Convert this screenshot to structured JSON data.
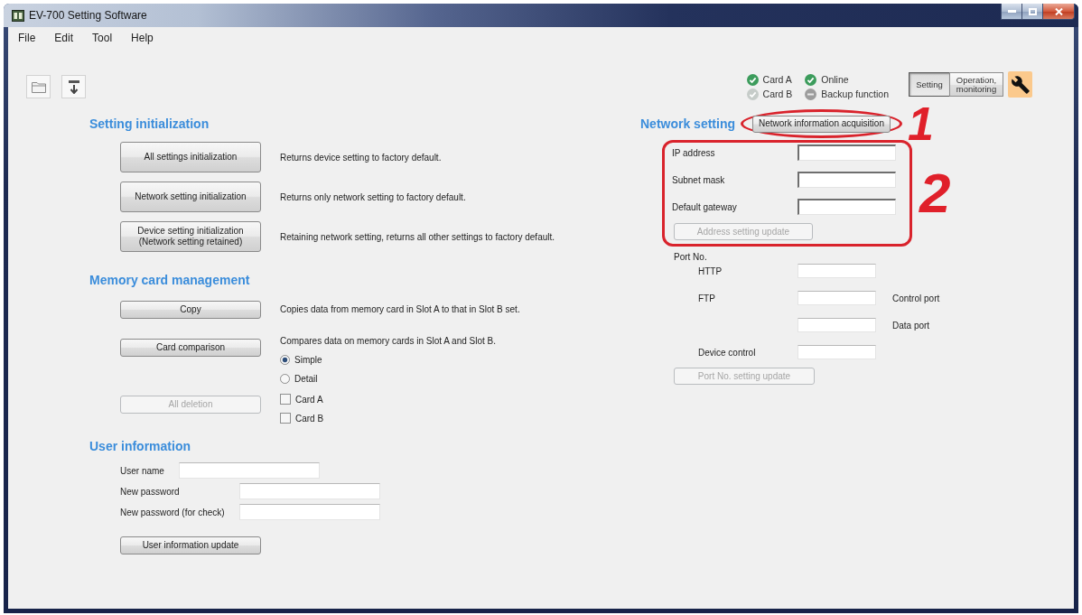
{
  "window": {
    "title": "EV-700 Setting Software"
  },
  "menu": [
    "File",
    "Edit",
    "Tool",
    "Help"
  ],
  "status": [
    {
      "label": "Card A",
      "on": true,
      "disabled": false
    },
    {
      "label": "Card B",
      "on": false,
      "disabled": false
    },
    {
      "label": "Online",
      "on": true,
      "disabled": false
    },
    {
      "label": "Backup function",
      "on": false,
      "disabled": true
    }
  ],
  "modes": [
    {
      "label": "Setting",
      "selected": true
    },
    {
      "label": "Operation, monitoring",
      "selected": false
    }
  ],
  "setting_initialization": {
    "title": "Setting initialization",
    "rows": [
      {
        "button": {
          "label": "All settings initialization",
          "disabled": false
        },
        "description": "Returns device setting to factory default."
      },
      {
        "button": {
          "label": "Network setting initialization",
          "disabled": false
        },
        "description": "Returns only network setting to factory default."
      },
      {
        "button": {
          "label": "Device setting initialization (Network setting retained)",
          "disabled": false
        },
        "description": "Retaining network setting, returns all other settings to factory default."
      }
    ]
  },
  "memory_card_management": {
    "title": "Memory card management",
    "rows": [
      {
        "button": {
          "label": "Copy",
          "disabled": false
        },
        "description": "Copies data from memory card in Slot A to that in Slot B set."
      },
      {
        "button": {
          "label": "Card comparison",
          "disabled": false
        },
        "description": "Compares data on memory cards in Slot A and Slot B.",
        "radios": [
          {
            "label": "Simple",
            "selected": true
          },
          {
            "label": "Detail",
            "selected": false
          }
        ]
      },
      {
        "button": {
          "label": "All deletion",
          "disabled": true
        },
        "checkboxes": [
          {
            "label": "Card A",
            "checked": false
          },
          {
            "label": "Card B",
            "checked": false
          }
        ]
      }
    ]
  },
  "user_information": {
    "title": "User information",
    "fields": [
      {
        "label": "User name",
        "kind": "text"
      },
      {
        "label": "New password",
        "kind": "password"
      },
      {
        "label": "New password (for check)",
        "kind": "password"
      }
    ],
    "button": {
      "label": "User information update",
      "disabled": false
    }
  },
  "network_setting": {
    "title": "Network setting",
    "acquire_button": {
      "label": "Network information acquisition",
      "disabled": false,
      "callout": "1"
    },
    "address": {
      "callout": "2",
      "fields": [
        {
          "label": "IP address"
        },
        {
          "label": "Subnet mask"
        },
        {
          "label": "Default gateway"
        }
      ],
      "button": {
        "label": "Address setting update",
        "disabled": true
      }
    },
    "ports": {
      "title": "Port No.",
      "rows": [
        {
          "label": "HTTP"
        },
        {
          "label": "FTP",
          "note": "Control port"
        },
        {
          "note": "Data port"
        },
        {
          "label": "Device control"
        }
      ],
      "button": {
        "label": "Port No. setting update",
        "disabled": true
      }
    }
  }
}
